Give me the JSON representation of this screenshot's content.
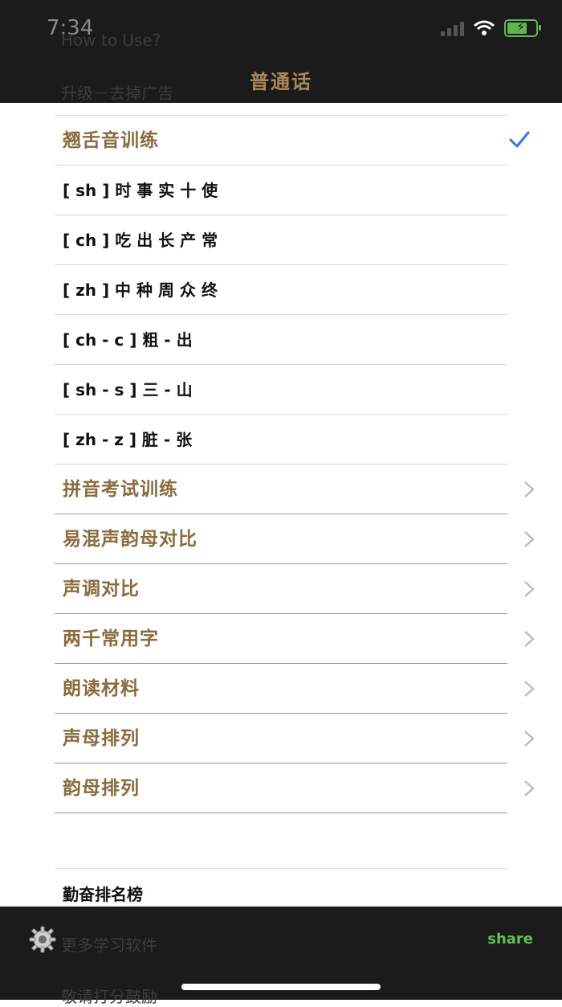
{
  "status_bar": {
    "time": "7:34"
  },
  "nav": {
    "title": "普通话",
    "behind_items": [
      "How to Use?",
      "升级－去掉广告"
    ]
  },
  "list": {
    "selected_section": {
      "label": "翘舌音训练",
      "selected": true
    },
    "sub_items": [
      "[ sh ]  时 事 实 十 使",
      "[ ch ]  吃 出 长 产 常",
      "[ zh ]  中 种 周 众 终",
      "[ ch - c ] 粗 - 出",
      "[ sh - s ] 三 - 山",
      "[ zh - z ] 脏 - 张"
    ],
    "sections": [
      "拼音考试训练",
      "易混声韵母对比",
      "声调对比",
      "两千常用字",
      "朗读材料",
      "声母排列",
      "韵母排列"
    ]
  },
  "footer_list": {
    "items": [
      "勤奋排名榜",
      "更多学习软件",
      "敬请打分鼓励"
    ]
  },
  "bottom_bar": {
    "share_label": "share"
  },
  "colors": {
    "accent": "#8b6b3d",
    "check": "#3478f6",
    "share": "#5fc24d",
    "bar": "#1b1b1b"
  }
}
